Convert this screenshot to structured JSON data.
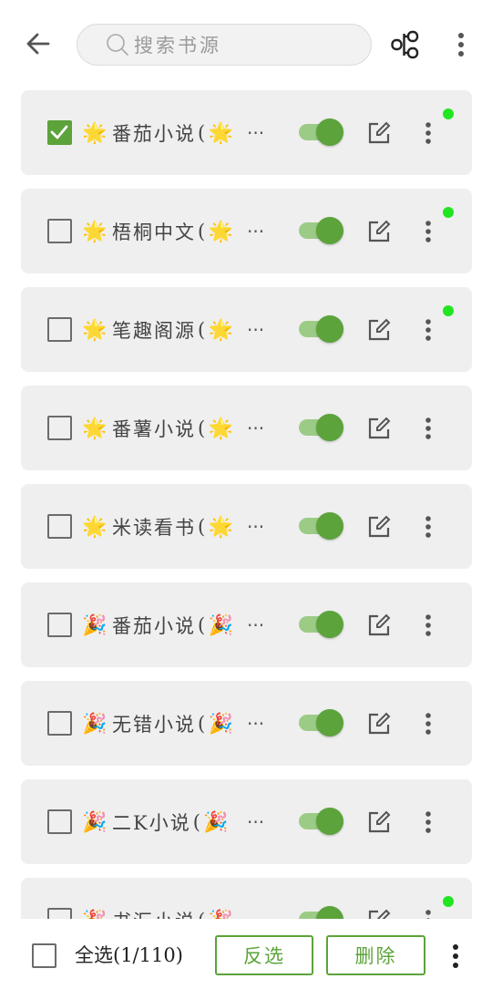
{
  "header": {
    "search_placeholder": "搜索书源"
  },
  "sources": [
    {
      "emoji": "🌟",
      "name": "番茄小说",
      "paren": "(",
      "emoji2": "🌟",
      "checked": true,
      "enabled": true,
      "dot": true
    },
    {
      "emoji": "🌟",
      "name": "梧桐中文",
      "paren": "(",
      "emoji2": "🌟",
      "checked": false,
      "enabled": true,
      "dot": true
    },
    {
      "emoji": "🌟",
      "name": "笔趣阁源",
      "paren": "(",
      "emoji2": "🌟",
      "checked": false,
      "enabled": true,
      "dot": true
    },
    {
      "emoji": "🌟",
      "name": "番薯小说",
      "paren": "(",
      "emoji2": "🌟",
      "checked": false,
      "enabled": true,
      "dot": false
    },
    {
      "emoji": "🌟",
      "name": "米读看书",
      "paren": "(",
      "emoji2": "🌟",
      "checked": false,
      "enabled": true,
      "dot": false
    },
    {
      "emoji": "🎉",
      "name": "番茄小说",
      "paren": "(",
      "emoji2": "🎉",
      "checked": false,
      "enabled": true,
      "dot": false
    },
    {
      "emoji": "🎉",
      "name": "无错小说",
      "paren": "(",
      "emoji2": "🎉",
      "checked": false,
      "enabled": true,
      "dot": false
    },
    {
      "emoji": "🎉",
      "name": "二K小说",
      "paren": "(",
      "emoji2": "🎉",
      "checked": false,
      "enabled": true,
      "dot": false
    },
    {
      "emoji": "🎉",
      "name": "书汇小说",
      "paren": "(",
      "emoji2": "🎉",
      "checked": false,
      "enabled": true,
      "dot": true
    }
  ],
  "ellipsis": "···",
  "footer": {
    "select_all_label": "全选(1/110)",
    "invert_label": "反选",
    "delete_label": "删除"
  },
  "colors": {
    "accent": "#5ba33a",
    "status_dot": "#22e522"
  }
}
